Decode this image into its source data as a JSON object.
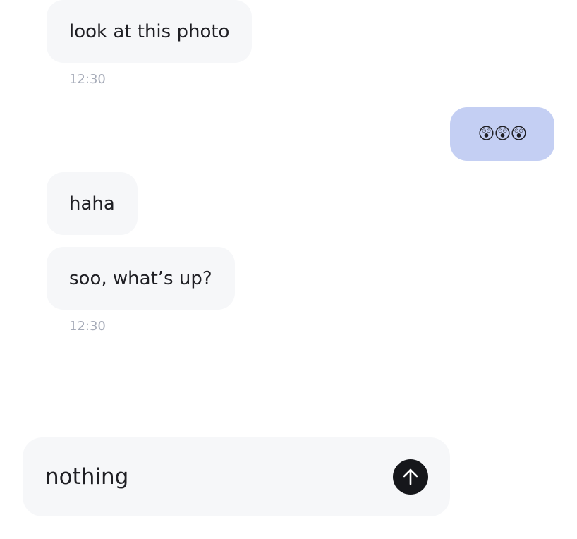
{
  "messages": [
    {
      "text": "look at this photo",
      "direction": "incoming"
    },
    {
      "text": "12:30",
      "kind": "timestamp"
    },
    {
      "text": "😲😲😲",
      "direction": "outgoing"
    },
    {
      "text": "haha",
      "direction": "incoming"
    },
    {
      "text": "soo, what’s up?",
      "direction": "incoming"
    },
    {
      "text": "12:30",
      "kind": "timestamp"
    }
  ],
  "composer": {
    "value": "nothing",
    "send_icon": "arrow-up-icon"
  },
  "colors": {
    "incoming_bubble": "#f6f7f9",
    "outgoing_bubble": "#c4cff3",
    "timestamp": "#a6abb8",
    "send_button": "#16171b"
  }
}
